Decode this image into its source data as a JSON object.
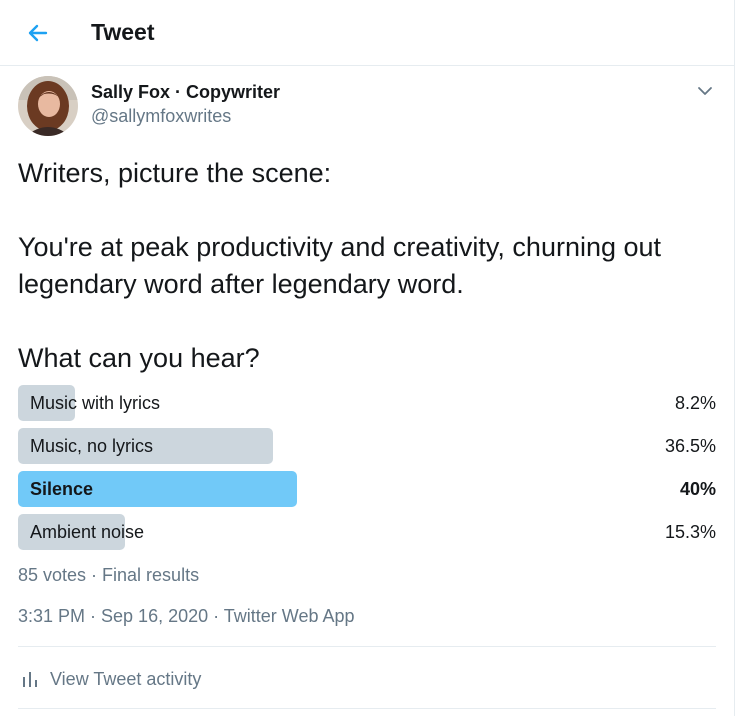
{
  "header": {
    "title": "Tweet"
  },
  "author": {
    "name": "Sally Fox · Copywriter",
    "handle": "@sallymfoxwrites"
  },
  "tweet": {
    "text": "Writers, picture the scene:\n\nYou're at peak productivity and creativity, churning out legendary word after legendary word.\n\nWhat can you hear?"
  },
  "poll": {
    "options": [
      {
        "label": "Music with lyrics",
        "percent_label": "8.2%",
        "share": 0.082,
        "winner": false
      },
      {
        "label": "Music, no lyrics",
        "percent_label": "36.5%",
        "share": 0.365,
        "winner": false
      },
      {
        "label": "Silence",
        "percent_label": "40%",
        "share": 0.4,
        "winner": true
      },
      {
        "label": "Ambient noise",
        "percent_label": "15.3%",
        "share": 0.153,
        "winner": false
      }
    ],
    "meta": "85 votes · Final results"
  },
  "timestamp": "3:31 PM · Sep 16, 2020 · Twitter Web App",
  "activity": {
    "label": "View Tweet activity"
  },
  "colors": {
    "accent": "#1da1f2",
    "winner_bar": "#71c9f8",
    "bar": "#ccd6dd",
    "secondary_text": "#657786"
  },
  "icons": {
    "back": "back-arrow-icon",
    "caret": "chevron-down-icon",
    "activity": "bar-chart-icon"
  }
}
